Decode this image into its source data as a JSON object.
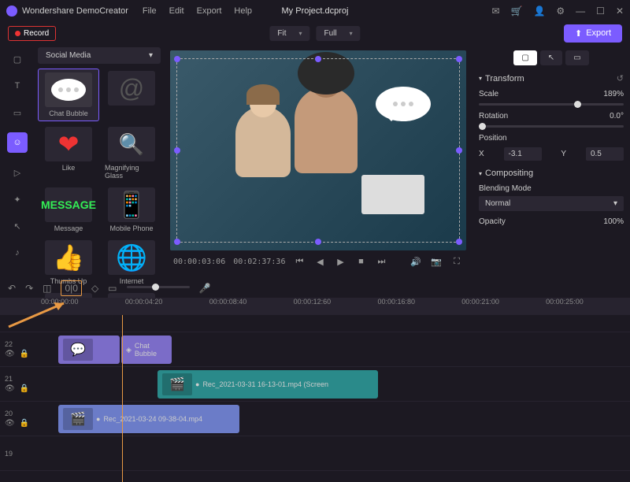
{
  "app_name": "Wondershare DemoCreator",
  "menu": [
    "File",
    "Edit",
    "Export",
    "Help"
  ],
  "filename": "My Project.dcproj",
  "record": "Record",
  "fit": "Fit",
  "full": "Full",
  "export": "Export",
  "lib_category": "Social Media",
  "items": [
    {
      "label": "Chat Bubble"
    },
    {
      "label": ""
    },
    {
      "label": "Like"
    },
    {
      "label": "Magnifying Glass"
    },
    {
      "label": "Message"
    },
    {
      "label": "Mobile Phone"
    },
    {
      "label": "Thumbs Up"
    },
    {
      "label": "Internet"
    }
  ],
  "time_current": "00:00:03:06",
  "time_total": "00:02:37:36",
  "props": {
    "transform": "Transform",
    "scale_lbl": "Scale",
    "scale_val": "189%",
    "rotation_lbl": "Rotation",
    "rotation_val": "0.0°",
    "position_lbl": "Position",
    "x_lbl": "X",
    "x_val": "-3.1",
    "y_lbl": "Y",
    "y_val": "0.5",
    "compositing": "Compositing",
    "blend_lbl": "Blending Mode",
    "blend_val": "Normal",
    "opacity_lbl": "Opacity",
    "opacity_val": "100%"
  },
  "ruler": [
    "00:00:00:00",
    "00:00:04:20",
    "00:00:08:40",
    "00:00:12:60",
    "00:00:16:80",
    "00:00:21:00",
    "00:00:25:00"
  ],
  "tracks": {
    "t22": "22",
    "t21": "21",
    "t20": "20",
    "t19": "19",
    "chat_bubble": "Chat Bubble",
    "rec1": "Rec_2021-03-31 16-13-01.mp4 (Screen",
    "rec2": "Rec_2021-03-24 09-38-04.mp4"
  }
}
